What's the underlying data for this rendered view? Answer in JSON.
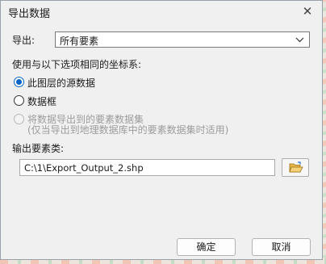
{
  "window": {
    "title": "导出数据"
  },
  "export": {
    "label": "导出:",
    "selected": "所有要素"
  },
  "coord": {
    "heading": "使用与以下选项相同的坐标系:",
    "options": [
      {
        "label": "此图层的源数据",
        "selected": true,
        "enabled": true
      },
      {
        "label": "数据框",
        "selected": false,
        "enabled": true
      },
      {
        "label": "将数据导出到的要素数据集",
        "note": "(仅当导出到地理数据库中的要素数据集时适用)",
        "selected": false,
        "enabled": false
      }
    ]
  },
  "output": {
    "label": "输出要素类:",
    "path": "C:\\1\\Export_Output_2.shp"
  },
  "buttons": {
    "ok": "确定",
    "cancel": "取消"
  },
  "colors": {
    "accent": "#0a64c8",
    "dialog_bg": "#f0f0f0"
  }
}
